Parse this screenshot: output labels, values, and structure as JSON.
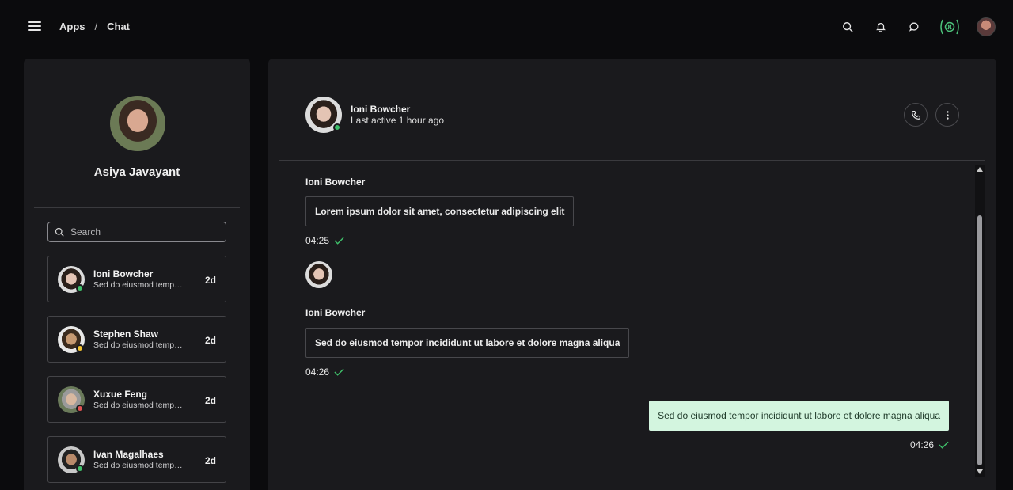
{
  "header": {
    "breadcrumb": [
      "Apps",
      "Chat"
    ],
    "separator": "/",
    "icons": [
      "menu-icon",
      "search-icon",
      "bell-icon",
      "chat-bubble-icon",
      "brain-icon",
      "user-avatar"
    ]
  },
  "sidebar": {
    "profile_name": "Asiya Javayant",
    "search_placeholder": "Search",
    "contacts": [
      {
        "name": "Ioni Bowcher",
        "preview": "Sed do eiusmod tempor incididunt ut labore et dolore magna aliqua",
        "time": "2d",
        "status": "online",
        "status_color": "#3fbf6a"
      },
      {
        "name": "Stephen Shaw",
        "preview": "Sed do eiusmod tempor incididunt ut labore et dolore magna aliqua",
        "time": "2d",
        "status": "away",
        "status_color": "#f2c12e"
      },
      {
        "name": "Xuxue Feng",
        "preview": "Sed do eiusmod tempor incididunt ut labore et dolore magna aliqua",
        "time": "2d",
        "status": "busy",
        "status_color": "#e05252"
      },
      {
        "name": "Ivan Magalhaes",
        "preview": "Sed do eiusmod tempor incididunt ut labore et dolore magna aliqua",
        "time": "2d",
        "status": "online",
        "status_color": "#3fbf6a"
      }
    ]
  },
  "chat": {
    "contact_name": "Ioni Bowcher",
    "last_active": "Last active 1 hour ago",
    "messages": [
      {
        "sender": "Ioni Bowcher",
        "text": "Lorem ipsum dolor sit amet, consectetur adipiscing elit",
        "time": "04:25",
        "direction": "incoming"
      },
      {
        "sender": "Ioni Bowcher",
        "text": "Sed do eiusmod tempor incididunt ut labore et dolore magna aliqua",
        "time": "04:26",
        "direction": "incoming"
      },
      {
        "sender": "",
        "text": "Sed do eiusmod tempor incididunt ut labore et dolore magna aliqua",
        "time": "04:26",
        "direction": "outgoing"
      }
    ]
  },
  "colors": {
    "accent_green": "#3fbf6a",
    "outgoing_bubble": "#d3f5df",
    "panel_bg": "#1a1a1d",
    "page_bg": "#0b0b0d"
  }
}
